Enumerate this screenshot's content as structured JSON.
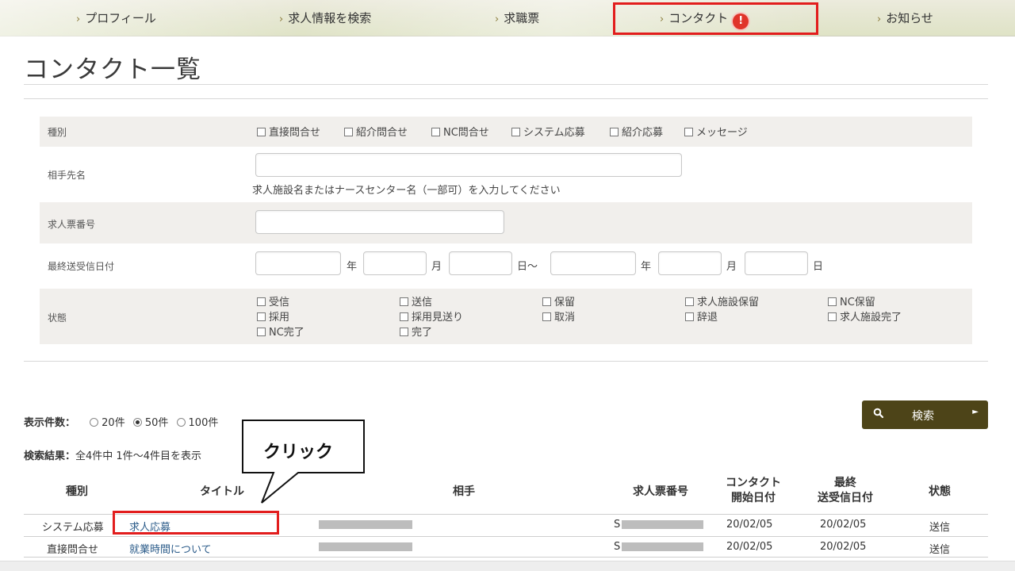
{
  "nav": {
    "items": [
      "プロフィール",
      "求人情報を検索",
      "求職票",
      "コンタクト",
      "お知らせ"
    ],
    "alert_mark": "!"
  },
  "page_title": "コンタクト一覧",
  "form": {
    "type": {
      "label": "種別",
      "options": [
        "直接問合せ",
        "紹介問合せ",
        "NC問合せ",
        "システム応募",
        "紹介応募",
        "メッセージ"
      ]
    },
    "partner": {
      "label": "相手先名",
      "value": "",
      "help": "求人施設名またはナースセンター名（一部可）を入力してください"
    },
    "job_number": {
      "label": "求人票番号",
      "value": ""
    },
    "last_date": {
      "label": "最終送受信日付",
      "units": [
        "年",
        "月",
        "日～",
        "年",
        "月",
        "日"
      ]
    },
    "status": {
      "label": "状態",
      "options": [
        [
          "受信",
          "採用",
          "NC完了"
        ],
        [
          "送信",
          "採用見送り",
          "完了"
        ],
        [
          "保留",
          "取消"
        ],
        [
          "求人施設保留",
          "辞退"
        ],
        [
          "NC保留",
          "求人施設完了"
        ]
      ]
    }
  },
  "per_page": {
    "label": "表示件数：",
    "options": [
      "20件",
      "50件",
      "100件"
    ],
    "selected": "50件"
  },
  "results": {
    "label": "検索結果：",
    "text": "全4件中 1件～4件目を表示"
  },
  "search_button": "検索",
  "table": {
    "headers": [
      "種別",
      "タイトル",
      "相手",
      "求人票番号",
      "コンタクト\n開始日付",
      "最終\n送受信日付",
      "状態"
    ],
    "rows": [
      {
        "type": "システム応募",
        "title": "求人応募",
        "job_prefix": "S",
        "start": "20/02/05",
        "last": "20/02/05",
        "status": "送信"
      },
      {
        "type": "直接問合せ",
        "title": "就業時間について",
        "job_prefix": "S",
        "start": "20/02/05",
        "last": "20/02/05",
        "status": "送信"
      }
    ]
  },
  "callout": {
    "text": "クリック"
  },
  "colors": {
    "highlight": "#e21d1d",
    "button": "#4d4418",
    "link": "#2c5c8a",
    "alert": "#e0342a"
  }
}
